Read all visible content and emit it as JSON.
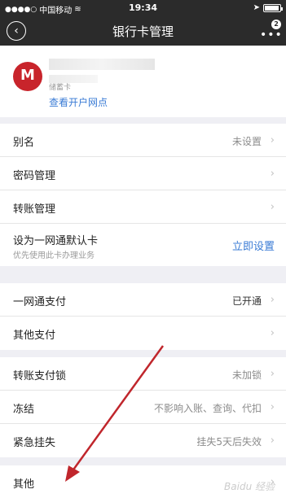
{
  "status_bar": {
    "carrier": "中国移动",
    "time": "19:34"
  },
  "nav": {
    "title": "银行卡管理",
    "back_icon": "‹",
    "badge": "2"
  },
  "card": {
    "logo_letter": "M",
    "type_label": "储蓄卡",
    "branch_link": "查看开户网点"
  },
  "group1": [
    {
      "label": "别名",
      "value": "未设置"
    },
    {
      "label": "密码管理",
      "value": ""
    },
    {
      "label": "转账管理",
      "value": ""
    },
    {
      "label": "设为一网通默认卡",
      "sublabel": "优先使用此卡办理业务",
      "value": "立即设置"
    }
  ],
  "group2": [
    {
      "label": "一网通支付",
      "value": "已开通"
    },
    {
      "label": "其他支付",
      "value": ""
    }
  ],
  "group3": [
    {
      "label": "转账支付锁",
      "value": "未加锁"
    },
    {
      "label": "冻结",
      "value": "不影响入账、查询、代扣"
    },
    {
      "label": "紧急挂失",
      "value": "挂失5天后失效"
    }
  ],
  "group4": [
    {
      "label": "其他",
      "value": ""
    }
  ],
  "watermark": "Baidu 经验"
}
